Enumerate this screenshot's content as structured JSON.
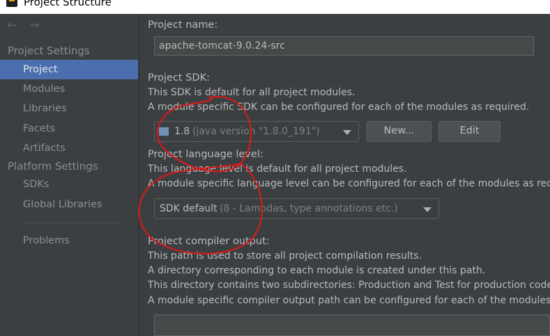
{
  "window": {
    "title": "Project Structure"
  },
  "sidebar": {
    "back_icon": "←",
    "forward_icon": "→",
    "group_project_settings": "Project Settings",
    "group_platform_settings": "Platform Settings",
    "items": [
      {
        "label": "Project"
      },
      {
        "label": "Modules"
      },
      {
        "label": "Libraries"
      },
      {
        "label": "Facets"
      },
      {
        "label": "Artifacts"
      },
      {
        "label": "SDKs"
      },
      {
        "label": "Global Libraries"
      },
      {
        "label": "Problems"
      }
    ]
  },
  "main": {
    "project_name_label": "Project name:",
    "project_name_value": "apache-tomcat-9.0.24-src",
    "sdk_label": "Project SDK:",
    "sdk_desc1": "This SDK is default for all project modules.",
    "sdk_desc2": "A module specific SDK can be configured for each of the modules as required.",
    "sdk_value_version": "1.8",
    "sdk_value_detail": "(java version \"1.8.0_191\")",
    "new_button": "New...",
    "edit_button": "Edit",
    "lang_label": "Project language level:",
    "lang_desc1": "This language level is default for all project modules.",
    "lang_desc2": "A module specific language level can be configured for each of the modules as requ",
    "lang_value_main": "SDK default",
    "lang_value_detail": "(8 - Lambdas, type annotations etc.)",
    "output_label": "Project compiler output:",
    "output_desc1": "This path is used to store all project compilation results.",
    "output_desc2": "A directory corresponding to each module is created under this path.",
    "output_desc3": "This directory contains two subdirectories: Production and Test for production code",
    "output_desc4": "A module specific compiler output path can be configured for each of the modules",
    "output_path_value": ""
  },
  "colors": {
    "selection": "#4b6eaf",
    "annotation": "#e01818"
  }
}
